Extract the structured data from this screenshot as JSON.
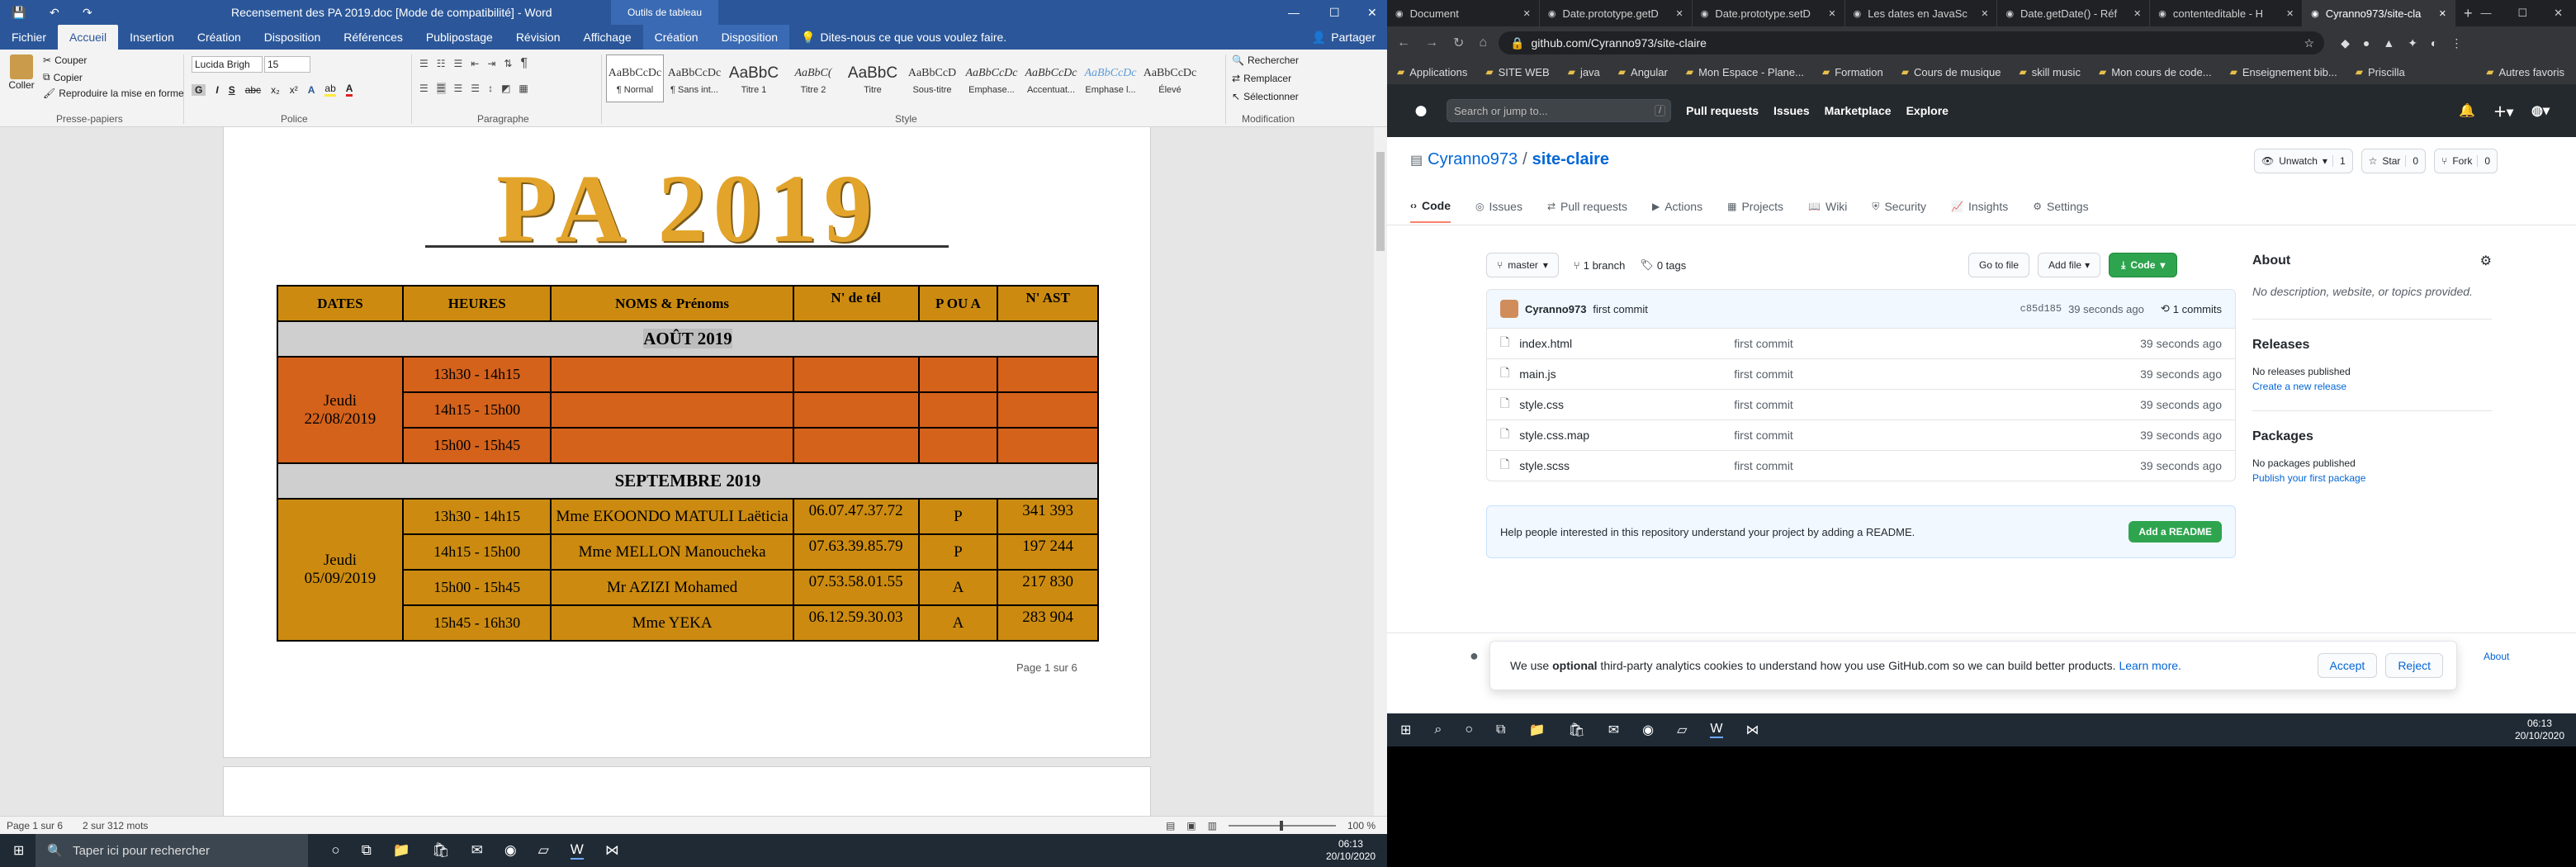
{
  "word": {
    "title": "Recensement des PA 2019.doc [Mode de compatibilité] - Word",
    "table_tools": "Outils de tableau",
    "window_controls": {
      "minimize": "—",
      "maximize": "☐",
      "close": "✕"
    },
    "tabs": [
      "Fichier",
      "Accueil",
      "Insertion",
      "Création",
      "Disposition",
      "Références",
      "Publipostage",
      "Révision",
      "Affichage",
      "Création",
      "Disposition"
    ],
    "tell_me": "Dites-nous ce que vous voulez faire.",
    "share": "Partager",
    "clipboard": {
      "paste": "Coller",
      "cut": "Couper",
      "copy": "Copier",
      "format": "Reproduire la mise en forme",
      "label": "Presse-papiers"
    },
    "font": {
      "name": "Lucida Brigh",
      "size": "15",
      "label": "Police",
      "bold": "G",
      "italic": "I",
      "underline": "S",
      "strike": "abc",
      "sub": "x₂",
      "sup": "x²",
      "clear": "A",
      "highlight": "ab",
      "color": "A"
    },
    "paragraph": {
      "label": "Paragraphe",
      "pilcrow": "¶"
    },
    "styles": {
      "label": "Style",
      "items": [
        {
          "preview": "AaBbCcDc",
          "name": "¶ Normal"
        },
        {
          "preview": "AaBbCcDc",
          "name": "¶ Sans int..."
        },
        {
          "preview": "AaBbC",
          "name": "Titre 1"
        },
        {
          "preview": "AaBbC(",
          "name": "Titre 2"
        },
        {
          "preview": "AaBbC",
          "name": "Titre"
        },
        {
          "preview": "AaBbCcD",
          "name": "Sous-titre"
        },
        {
          "preview": "AaBbCcDc",
          "name": "Emphase..."
        },
        {
          "preview": "AaBbCcDc",
          "name": "Accentuat..."
        },
        {
          "preview": "AaBbCcDc",
          "name": "Emphase l..."
        },
        {
          "preview": "AaBbCcDc",
          "name": "Élevé"
        }
      ]
    },
    "editing": {
      "find": "Rechercher",
      "replace": "Remplacer",
      "select": "Sélectionner",
      "label": "Modification"
    },
    "document": {
      "heading": "PA 2019",
      "headers": [
        "DATES",
        "HEURES",
        "NOMS & Prénoms",
        "N' de tél",
        "P OU A",
        "N' AST"
      ],
      "months": [
        {
          "month": "AOÛT 2019",
          "date": "Jeudi 22/08/2019",
          "rows": [
            {
              "time": "13h30 - 14h15",
              "name": "",
              "tel": "",
              "pa": "",
              "ast": ""
            },
            {
              "time": "14h15 - 15h00",
              "name": "",
              "tel": "",
              "pa": "",
              "ast": ""
            },
            {
              "time": "15h00 - 15h45",
              "name": "",
              "tel": "",
              "pa": "",
              "ast": ""
            }
          ]
        },
        {
          "month": "SEPTEMBRE 2019",
          "date": "Jeudi 05/09/2019",
          "rows": [
            {
              "time": "13h30 - 14h15",
              "name": "Mme EKOONDO MATULI Laëticia",
              "tel": "06.07.47.37.72",
              "pa": "P",
              "ast": "341 393"
            },
            {
              "time": "14h15 - 15h00",
              "name": "Mme MELLON Manoucheka",
              "tel": "07.63.39.85.79",
              "pa": "P",
              "ast": "197 244"
            },
            {
              "time": "15h00 - 15h45",
              "name": "Mr AZIZI Mohamed",
              "tel": "07.53.58.01.55",
              "pa": "A",
              "ast": "217 830"
            },
            {
              "time": "15h45 - 16h30",
              "name": "Mme YEKA",
              "tel": "06.12.59.30.03",
              "pa": "A",
              "ast": "283 904"
            }
          ]
        }
      ],
      "page_footer": "Page 1 sur 6"
    },
    "status": {
      "page": "Page 1 sur 6",
      "words": "2 sur 312 mots",
      "zoom": "100 %"
    }
  },
  "taskbar_left": {
    "search": "Taper ici pour rechercher",
    "time": "06:13",
    "date": "20/10/2020"
  },
  "browser": {
    "tabs": [
      "Document",
      "Date.prototype.getD",
      "Date.prototype.setD",
      "Les dates en JavaSc",
      "Date.getDate() - Réf",
      "contenteditable - H",
      "Cyranno973/site-cla"
    ],
    "new_tab": "+",
    "url": "github.com/Cyranno973/site-claire",
    "bookmarks": [
      "Applications",
      "SITE WEB",
      "java",
      "Angular",
      "Mon Espace - Plane...",
      "Formation",
      "Cours de musique",
      "skill music",
      "Mon cours de code...",
      "Enseignement bib...",
      "Priscilla",
      "Autres favoris"
    ]
  },
  "github": {
    "search_placeholder": "Search or jump to...",
    "search_key": "/",
    "nav": [
      "Pull requests",
      "Issues",
      "Marketplace",
      "Explore"
    ],
    "owner": "Cyranno973",
    "sep": "/",
    "repo": "site-claire",
    "unwatch": "Unwatch",
    "unwatch_count": "1",
    "star": "Star",
    "star_count": "0",
    "fork": "Fork",
    "fork_count": "0",
    "repo_tabs": [
      "Code",
      "Issues",
      "Pull requests",
      "Actions",
      "Projects",
      "Wiki",
      "Security",
      "Insights",
      "Settings"
    ],
    "branch": "master",
    "branches": "1 branch",
    "tags": "0 tags",
    "goto_file": "Go to file",
    "add_file": "Add file",
    "code": "Code",
    "commit": {
      "author": "Cyranno973",
      "message": "first commit",
      "sha": "c85d185",
      "time": "39 seconds ago",
      "count": "1 commits"
    },
    "files": [
      {
        "name": "index.html",
        "msg": "first commit",
        "time": "39 seconds ago"
      },
      {
        "name": "main.js",
        "msg": "first commit",
        "time": "39 seconds ago"
      },
      {
        "name": "style.css",
        "msg": "first commit",
        "time": "39 seconds ago"
      },
      {
        "name": "style.css.map",
        "msg": "first commit",
        "time": "39 seconds ago"
      },
      {
        "name": "style.scss",
        "msg": "first commit",
        "time": "39 seconds ago"
      }
    ],
    "readme_prompt": "Help people interested in this repository understand your project by adding a README.",
    "add_readme": "Add a README",
    "about_title": "About",
    "about_text": "No description, website, or topics provided.",
    "releases_title": "Releases",
    "releases_text": "No releases published",
    "releases_link": "Create a new release",
    "packages_title": "Packages",
    "packages_text": "No packages published",
    "packages_link": "Publish your first package",
    "cookie_pre": "We use ",
    "cookie_bold": "optional",
    "cookie_post": " third-party analytics cookies to understand how you use GitHub.com so we can build better products. ",
    "cookie_link": "Learn more.",
    "accept": "Accept",
    "reject": "Reject",
    "about_footer": "About"
  },
  "taskbar_right": {
    "time": "06:13",
    "date": "20/10/2020"
  }
}
